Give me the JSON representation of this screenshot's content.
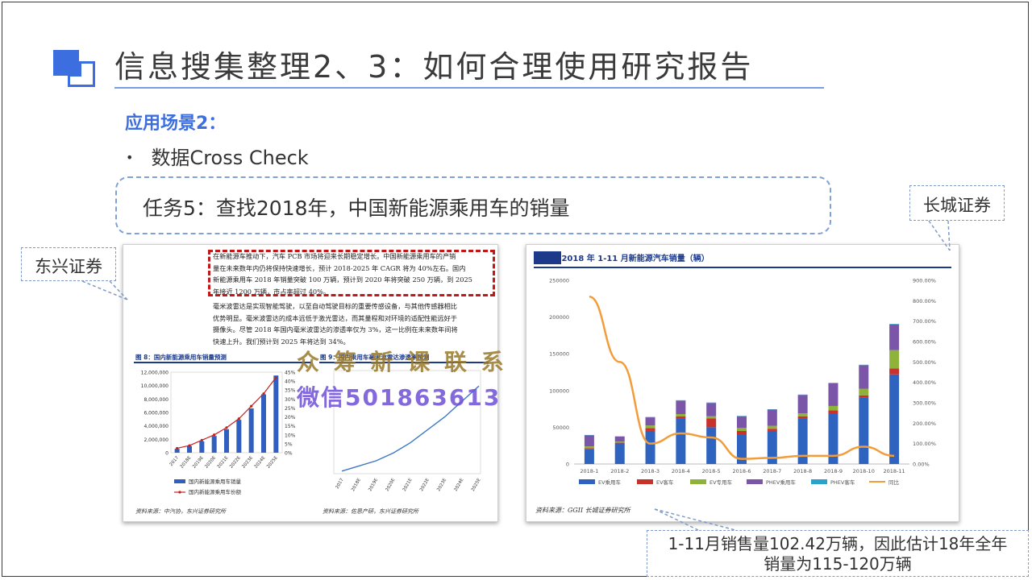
{
  "slide": {
    "title": "信息搜集整理2、3：如何合理使用研究报告",
    "scene_label": "应用场景2：",
    "bullet": "数据Cross Check",
    "bullet_marker": "•",
    "task": "任务5：查找2018年，中国新能源乘用车的销量",
    "callout_left": "东兴证券",
    "callout_right": "长城证券",
    "callout_bottom_line1": "1-11月销售量102.42万辆，因此估计18年全年",
    "callout_bottom_line2": "销量为115-120万辆",
    "accent_color": "#3d6ee0"
  },
  "left_report": {
    "paragraph1_lines": [
      "在新能源车推动下，汽车 PCB 市场将迎来长期稳定增长。中国新能源乘用车的产销",
      "量在未来数年内仍将保持快速增长，预计 2018-2025 年 CAGR 将为 40%左右。国内",
      "新能源乘用车 2018 年销量突破 100 万辆，预计到 2020 年将突破 250 万辆，到 2025",
      "年接近 1200 万辆，市占率超过 40%。"
    ],
    "paragraph2_lines": [
      "毫米波雷达是实现智能驾驶，以至自动驾驶目标的重要传感设备，与其他传感器相比",
      "优势明显。毫米波雷达的成本远低于激光雷达，而其量程和对环境的适配性能远好于",
      "摄像头。尽管 2018 年国内毫米波雷达的渗透率仅为 3%，这一比例在未来数年间将",
      "快速上升。我们预计到 2025 年将达到 34%。"
    ],
    "fig8_title": "图 8：国内新能源乘用车销量预测",
    "fig9_title": "图 9：国内乘用车毫米波雷达渗透率预测",
    "source8": "资料来源：中汽协，东兴证券研究所",
    "source9": "资料来源：佐思产研，东兴证券研究所"
  },
  "right_report": {
    "source": "资料来源：GGII  长城证券研究所"
  },
  "watermark": {
    "line1": "众 筹 新 课 联 系",
    "line2": "微信501863613"
  },
  "chart_data": [
    {
      "id": "fig8",
      "type": "bar",
      "categories": [
        "2017",
        "2018E",
        "2019E",
        "2020E",
        "2021E",
        "2022E",
        "2023E",
        "2024E",
        "2025E"
      ],
      "series": [
        {
          "name": "国内新能源乘用车销量",
          "axis": "left",
          "values": [
            580000,
            1000000,
            1700000,
            2500000,
            3500000,
            4900000,
            6600000,
            8700000,
            11500000
          ],
          "color": "#2f5fbf"
        },
        {
          "name": "国内新能源乘用车份额",
          "axis": "right",
          "type": "line",
          "values": [
            2.5,
            4,
            7,
            10,
            14,
            19,
            26,
            33,
            42
          ],
          "color": "#c8201c"
        }
      ],
      "left_ticks": [
        "0",
        "2,000,000",
        "4,000,000",
        "6,000,000",
        "8,000,000",
        "10,000,000",
        "12,000,000"
      ],
      "right_ticks": [
        "0%",
        "5%",
        "10%",
        "15%",
        "20%",
        "25%",
        "30%",
        "35%",
        "40%",
        "45%"
      ],
      "ylim": [
        0,
        12000000
      ],
      "y2lim": [
        0,
        45
      ]
    },
    {
      "id": "fig9",
      "type": "line",
      "categories": [
        "2017",
        "2018E",
        "2019E",
        "2020E",
        "2021E",
        "2022E",
        "2023E",
        "2024E",
        "2025E"
      ],
      "series": [
        {
          "name": "",
          "values": [
            1,
            3,
            5,
            8,
            12,
            17,
            22,
            28,
            34
          ],
          "color": "#3d78c8"
        }
      ],
      "ylim": [
        0,
        40
      ]
    },
    {
      "id": "fig1",
      "type": "bar",
      "title": "图 1：2018 年 1-11 月新能源汽车销量（辆）",
      "stacked": true,
      "categories": [
        "2018-1",
        "2018-2",
        "2018-3",
        "2018-4",
        "2018-5",
        "2018-6",
        "2018-7",
        "2018-8",
        "2018-9",
        "2018-10",
        "2018-11"
      ],
      "series": [
        {
          "name": "EV乘用车",
          "values": [
            20000,
            28000,
            45000,
            62000,
            50000,
            40000,
            45000,
            62000,
            68000,
            90000,
            122000
          ],
          "color": "#2e63c0"
        },
        {
          "name": "EV客车",
          "values": [
            1500,
            1000,
            4000,
            3000,
            12000,
            5000,
            3000,
            3000,
            5000,
            3500,
            8000
          ],
          "color": "#c8322d"
        },
        {
          "name": "EV专用车",
          "values": [
            2500,
            1500,
            3500,
            3000,
            3000,
            4000,
            4000,
            4000,
            6000,
            9000,
            25000
          ],
          "color": "#8fb33a"
        },
        {
          "name": "PHEV乘用车",
          "values": [
            15000,
            7000,
            11000,
            18000,
            18000,
            16000,
            22000,
            25000,
            31000,
            32000,
            35000
          ],
          "color": "#7a55a8"
        },
        {
          "name": "PHEV客车",
          "values": [
            500,
            200,
            500,
            800,
            700,
            500,
            500,
            500,
            500,
            600,
            700
          ],
          "color": "#2aa3cc"
        },
        {
          "name": "同比",
          "axis": "right",
          "type": "line",
          "values": [
            820,
            500,
            100,
            150,
            130,
            25,
            30,
            40,
            40,
            85,
            40
          ],
          "color": "#f39c3a"
        }
      ],
      "left_ticks": [
        "0",
        "50000",
        "100000",
        "150000",
        "200000",
        "250000"
      ],
      "right_ticks": [
        "0.00%",
        "100.00%",
        "200.00%",
        "300.00%",
        "400.00%",
        "500.00%",
        "600.00%",
        "700.00%",
        "800.00%",
        "900.00%"
      ],
      "ylim": [
        0,
        250000
      ],
      "y2lim": [
        0,
        900
      ]
    }
  ]
}
